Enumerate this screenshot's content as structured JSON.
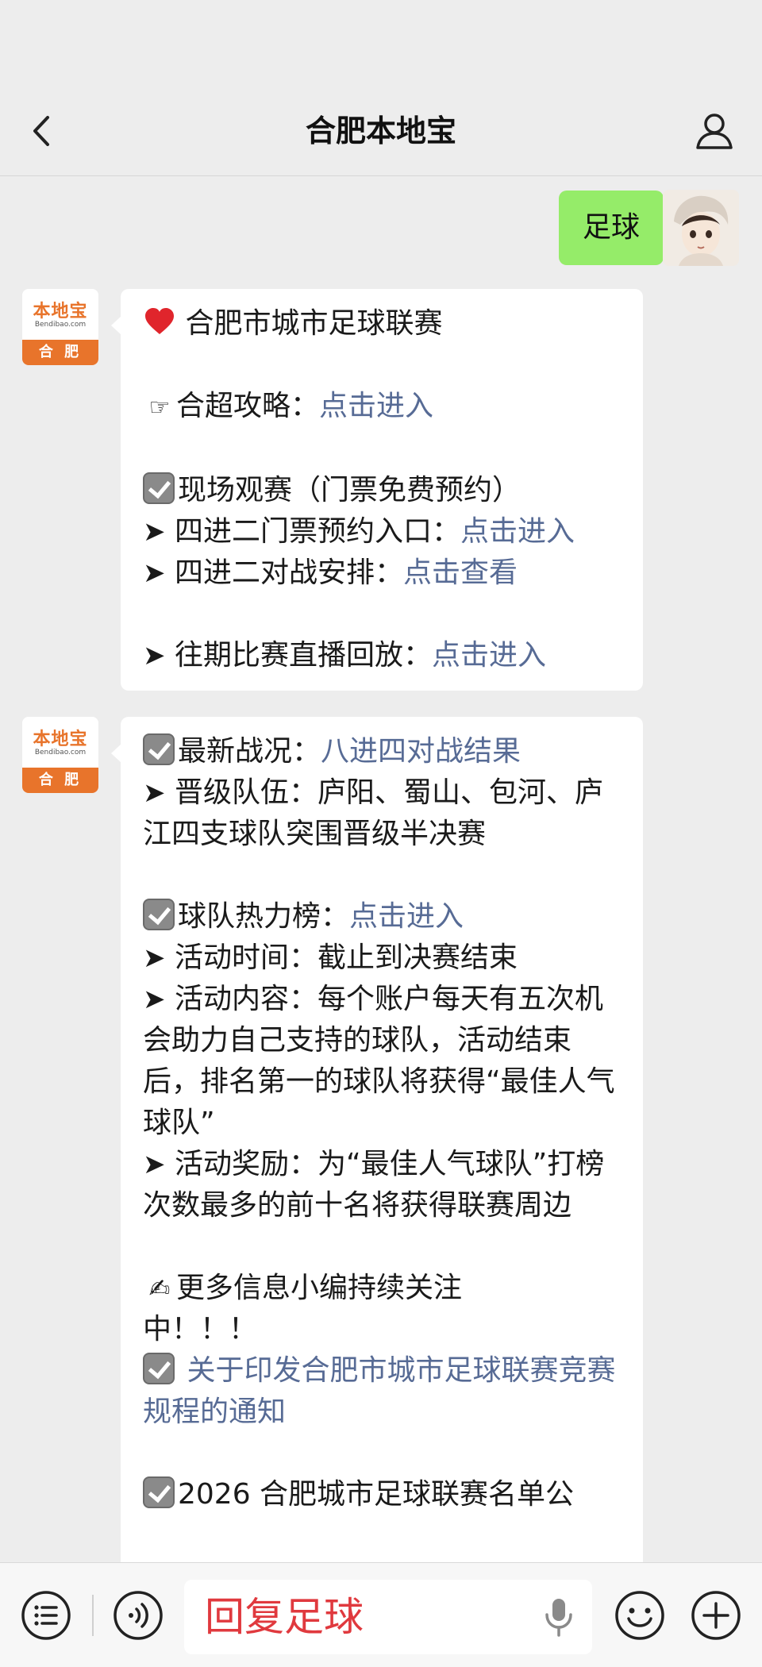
{
  "header": {
    "title": "合肥本地宝"
  },
  "user": {
    "message": "足球"
  },
  "bot_avatar": {
    "brand": "本地宝",
    "site": "Bendibao.com",
    "city": "合 肥"
  },
  "msg1": {
    "l1_text": "合肥市城市足球联赛",
    "l2_text": "合超攻略：",
    "l2_link": "点击进入",
    "l3_text": "现场观赛（门票免费预约）",
    "l4_text": "四进二门票预约入口：",
    "l4_link": "点击进入",
    "l5_text": "四进二对战安排：",
    "l5_link": "点击查看",
    "l6_text": "往期比赛直播回放：",
    "l6_link": "点击进入"
  },
  "msg2": {
    "l1_text": "最新战况：",
    "l1_link": "八进四对战结果",
    "l2_text": "晋级队伍：庐阳、蜀山、包河、庐江四支球队突围晋级半决赛",
    "l3_text": "球队热力榜：",
    "l3_link": "点击进入",
    "l4_text": "活动时间：截止到决赛结束",
    "l5_text": "活动内容：每个账户每天有五次机会助力自己支持的球队，活动结束后，排名第一的球队将获得“最佳人气球队”",
    "l6_text": "活动奖励：为“最佳人气球队”打榜次数最多的前十名将获得联赛周边",
    "l7_text": "更多信息小编持续关注",
    "l8_text": "中！！！",
    "l9_link": "关于印发合肥市城市足球联赛竞赛规程的通知",
    "l10_text": "2026 合肥城市足球联赛名单公"
  },
  "input": {
    "reply_text": "回复足球"
  },
  "colors": {
    "link": "#576b95",
    "user_bubble": "#95ec69",
    "reply_text": "#e0393e",
    "brand": "#e8742b"
  }
}
